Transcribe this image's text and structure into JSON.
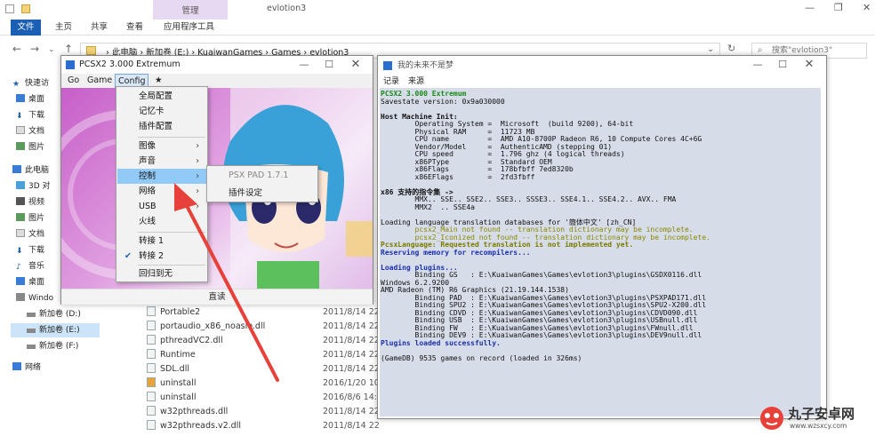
{
  "explorer": {
    "title_tab_manage": "管理",
    "title_text": "evlotion3",
    "ribbon_tabs": [
      "文件",
      "主页",
      "共享",
      "查看",
      "应用程序工具"
    ],
    "path": [
      "此电脑",
      "新加卷 (E:)",
      "KuaiwanGames",
      "Games",
      "evlotion3"
    ],
    "search_placeholder": "搜索\"evlotion3\"",
    "sidebar": [
      "快速访",
      "桌面",
      "下载",
      "文档",
      "图片",
      "此电脑",
      "3D 对",
      "视频",
      "图片",
      "文档",
      "下载",
      "音乐",
      "桌面",
      "Windo",
      "新加卷 (D:)",
      "新加卷 (E:)",
      "新加卷 (F:)",
      "网络"
    ],
    "files": [
      {
        "name": "Portable2",
        "date": "2011/8/14 22"
      },
      {
        "name": "portaudio_x86_noasio.dll",
        "date": "2011/8/14 22"
      },
      {
        "name": "pthreadVC2.dll",
        "date": "2011/8/14 22"
      },
      {
        "name": "Runtime",
        "date": "2011/8/14 22"
      },
      {
        "name": "SDL.dll",
        "date": "2011/8/14 22"
      },
      {
        "name": "uninstall",
        "date": "2016/1/20 10"
      },
      {
        "name": "uninstall",
        "date": "2016/8/6 14:1"
      },
      {
        "name": "w32pthreads.dll",
        "date": "2011/8/14 22"
      },
      {
        "name": "w32pthreads.v2.dll",
        "date": "2011/8/14 22"
      }
    ]
  },
  "pcsx2": {
    "title": "PCSX2 3.000 Extremum",
    "menus": [
      "Go",
      "Game",
      "Config",
      "★"
    ],
    "status": "直读",
    "config_menu": [
      "全局配置",
      "记忆卡",
      "插件配置",
      "图像",
      "声音",
      "控制",
      "网络",
      "USB",
      "火线",
      "转接 1",
      "转接 2",
      "回归到无"
    ],
    "submenu": [
      "PSX PAD 1.7.1",
      "插件设定"
    ]
  },
  "console": {
    "title": "我的未来不是梦",
    "menus": [
      "记录",
      "来源"
    ],
    "lines": [
      {
        "t": "PCSX2 3.000 Extremum",
        "c": "c-green"
      },
      {
        "t": "Savestate version: 0x9a030000",
        "c": ""
      },
      {
        "t": "",
        "c": ""
      },
      {
        "t": "Host Machine Init:",
        "c": "c-bold"
      },
      {
        "t": "        Operating System =  Microsoft  (build 9200), 64-bit",
        "c": ""
      },
      {
        "t": "        Physical RAM     =  11723 MB",
        "c": ""
      },
      {
        "t": "        CPU name         =  AMD A10-8700P Radeon R6, 10 Compute Cores 4C+6G",
        "c": ""
      },
      {
        "t": "        Vendor/Model     =  AuthenticAMD (stepping 01)",
        "c": ""
      },
      {
        "t": "        CPU speed        =  1.796 ghz (4 logical threads)",
        "c": ""
      },
      {
        "t": "        x86PType         =  Standard OEM",
        "c": ""
      },
      {
        "t": "        x86Flags         =  178bfbff 7ed8320b",
        "c": ""
      },
      {
        "t": "        x86EFlags        =  2fd3fbff",
        "c": ""
      },
      {
        "t": "",
        "c": ""
      },
      {
        "t": "x86 支持的指令集 ->",
        "c": "c-bold"
      },
      {
        "t": "        MMX.. SSE.. SSE2.. SSE3.. SSSE3.. SSE4.1.. SSE4.2.. AVX.. FMA",
        "c": ""
      },
      {
        "t": "        MMX2  .. SSE4a",
        "c": ""
      },
      {
        "t": "",
        "c": ""
      },
      {
        "t": "Loading language translation databases for '簡体中文' [zh_CN]",
        "c": ""
      },
      {
        "t": "        pcsx2_Main not found -- translation dictionary may be incomplete.",
        "c": "c-olive"
      },
      {
        "t": "        pcsx2_Iconized not found -- translation dictionary may be incomplete.",
        "c": "c-olive"
      },
      {
        "t": "PcsxLanguage: Requested translation is not implemented yet.",
        "c": "c-yellowbold"
      },
      {
        "t": "Reserving memory for recompilers...",
        "c": "c-blue"
      },
      {
        "t": "",
        "c": ""
      },
      {
        "t": "Loading plugins...",
        "c": "c-blue"
      },
      {
        "t": "        Binding GS   : E:\\KuaiwanGames\\Games\\evlotion3\\plugins\\GSDX0116.dll",
        "c": ""
      },
      {
        "t": "Windows 6.2.9200",
        "c": ""
      },
      {
        "t": "AMD Radeon (TM) R6 Graphics (21.19.144.1538)",
        "c": ""
      },
      {
        "t": "        Binding PAD  : E:\\KuaiwanGames\\Games\\evlotion3\\plugins\\PSXPAD171.dll",
        "c": ""
      },
      {
        "t": "        Binding SPU2 : E:\\KuaiwanGames\\Games\\evlotion3\\plugins\\SPU2-X200.dll",
        "c": ""
      },
      {
        "t": "        Binding CDVD : E:\\KuaiwanGames\\Games\\evlotion3\\plugins\\CDVD090.dll",
        "c": ""
      },
      {
        "t": "        Binding USB  : E:\\KuaiwanGames\\Games\\evlotion3\\plugins\\USBnull.dll",
        "c": ""
      },
      {
        "t": "        Binding FW   : E:\\KuaiwanGames\\Games\\evlotion3\\plugins\\FWnull.dll",
        "c": ""
      },
      {
        "t": "        Binding DEV9 : E:\\KuaiwanGames\\Games\\evlotion3\\plugins\\DEV9null.dll",
        "c": ""
      },
      {
        "t": "Plugins loaded successfully.",
        "c": "c-blue"
      },
      {
        "t": "",
        "c": ""
      },
      {
        "t": "(GameDB) 9535 games on record (loaded in 326ms)",
        "c": ""
      }
    ]
  },
  "watermark": {
    "name": "丸子安卓网",
    "url": "www.wzsxcy.com"
  },
  "colors": {
    "highlight": "#91c9f7",
    "arrow": "#e8413a",
    "file_tab": "#1a5fb4"
  }
}
